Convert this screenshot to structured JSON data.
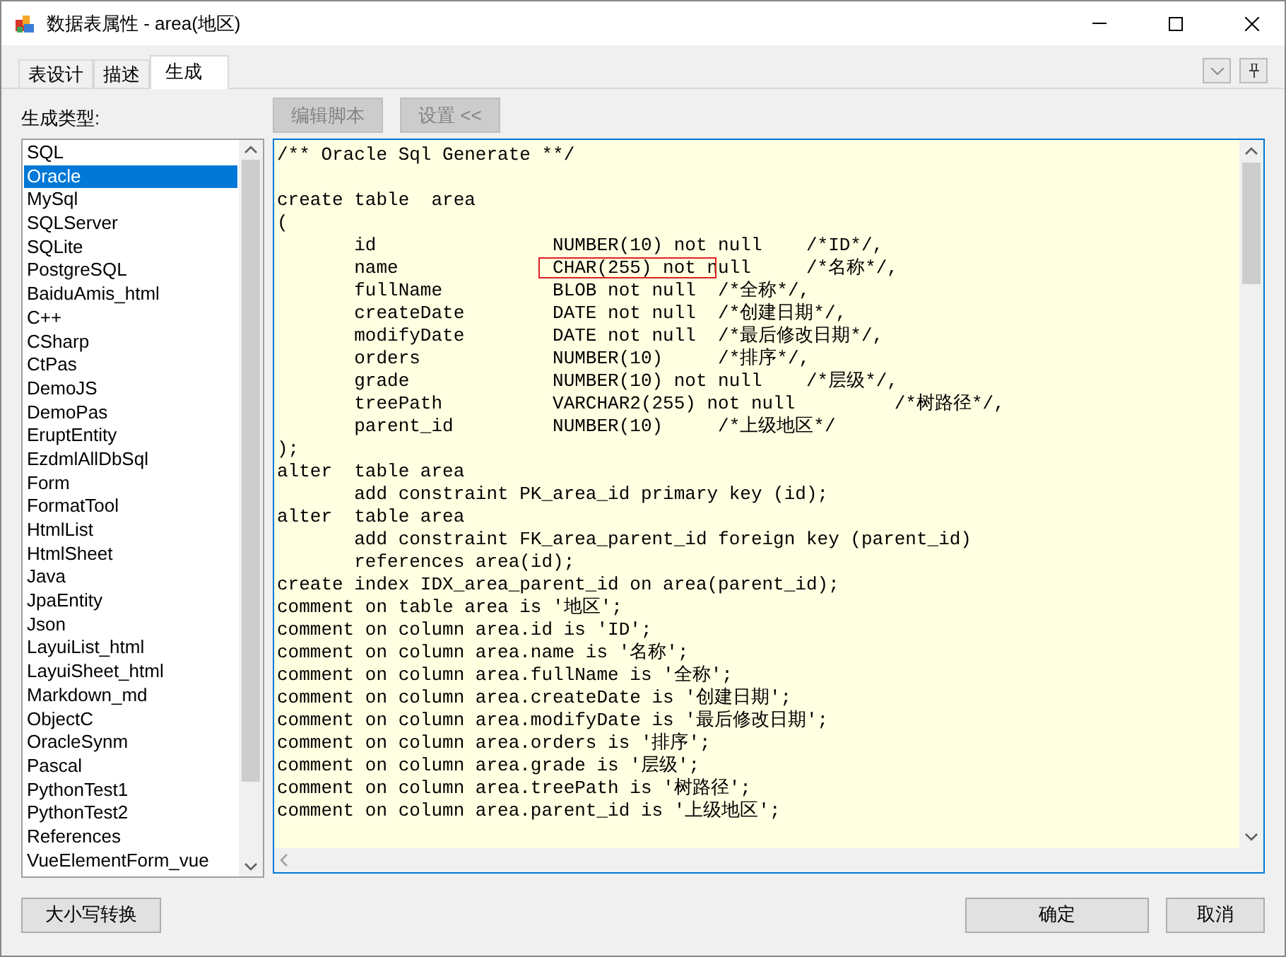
{
  "window": {
    "title": "数据表属性 - area(地区)"
  },
  "tabs": [
    {
      "label": "表设计",
      "selected": false
    },
    {
      "label": "描述",
      "selected": false
    },
    {
      "label": "生成",
      "selected": true
    }
  ],
  "generate_type_label": "生成类型:",
  "toolbar_buttons": [
    {
      "label": "编辑脚本",
      "disabled": true
    },
    {
      "label": "设置 <<",
      "disabled": true
    }
  ],
  "types": [
    {
      "label": "SQL",
      "selected": false
    },
    {
      "label": "Oracle",
      "selected": true
    },
    {
      "label": "MySql",
      "selected": false
    },
    {
      "label": "SQLServer",
      "selected": false
    },
    {
      "label": "SQLite",
      "selected": false
    },
    {
      "label": "PostgreSQL",
      "selected": false
    },
    {
      "label": "BaiduAmis_html",
      "selected": false
    },
    {
      "label": "C++",
      "selected": false
    },
    {
      "label": "CSharp",
      "selected": false
    },
    {
      "label": "CtPas",
      "selected": false
    },
    {
      "label": "DemoJS",
      "selected": false
    },
    {
      "label": "DemoPas",
      "selected": false
    },
    {
      "label": "EruptEntity",
      "selected": false
    },
    {
      "label": "EzdmlAllDbSql",
      "selected": false
    },
    {
      "label": "Form",
      "selected": false
    },
    {
      "label": "FormatTool",
      "selected": false
    },
    {
      "label": "HtmlList",
      "selected": false
    },
    {
      "label": "HtmlSheet",
      "selected": false
    },
    {
      "label": "Java",
      "selected": false
    },
    {
      "label": "JpaEntity",
      "selected": false
    },
    {
      "label": "Json",
      "selected": false
    },
    {
      "label": "LayuiList_html",
      "selected": false
    },
    {
      "label": "LayuiSheet_html",
      "selected": false
    },
    {
      "label": "Markdown_md",
      "selected": false
    },
    {
      "label": "ObjectC",
      "selected": false
    },
    {
      "label": "OracleSynm",
      "selected": false
    },
    {
      "label": "Pascal",
      "selected": false
    },
    {
      "label": "PythonTest1",
      "selected": false
    },
    {
      "label": "PythonTest2",
      "selected": false
    },
    {
      "label": "References",
      "selected": false
    },
    {
      "label": "VueElementForm_vue",
      "selected": false
    }
  ],
  "code_lines": [
    {
      "text": "/** Oracle Sql Generate **/",
      "boxed": false
    },
    {
      "boxed": false
    },
    {
      "text": "create table  area",
      "boxed": false
    },
    {
      "text": "(",
      "boxed": false
    },
    {
      "text": "       id                NUMBER(10) not null    /*ID*/,",
      "boxed": false
    },
    {
      "text": "       name              CHAR(255) not null     /*名称*/,",
      "boxed": true
    },
    {
      "text": "       fullName          BLOB not null  /*全称*/,",
      "boxed": false
    },
    {
      "text": "       createDate        DATE not null  /*创建日期*/,",
      "boxed": false
    },
    {
      "text": "       modifyDate        DATE not null  /*最后修改日期*/,",
      "boxed": false
    },
    {
      "text": "       orders            NUMBER(10)     /*排序*/,",
      "boxed": false
    },
    {
      "text": "       grade             NUMBER(10) not null    /*层级*/,",
      "boxed": false
    },
    {
      "text": "       treePath          VARCHAR2(255) not null         /*树路径*/,",
      "boxed": false
    },
    {
      "text": "       parent_id         NUMBER(10)     /*上级地区*/",
      "boxed": false
    },
    {
      "text": ");",
      "boxed": false
    },
    {
      "text": "alter  table area",
      "boxed": false
    },
    {
      "text": "       add constraint PK_area_id primary key (id);",
      "boxed": false
    },
    {
      "text": "alter  table area",
      "boxed": false
    },
    {
      "text": "       add constraint FK_area_parent_id foreign key (parent_id)",
      "boxed": false
    },
    {
      "text": "       references area(id);",
      "boxed": false
    },
    {
      "text": "create index IDX_area_parent_id on area(parent_id);",
      "boxed": false
    },
    {
      "text": "comment on table area is '地区';",
      "boxed": false
    },
    {
      "text": "comment on column area.id is 'ID';",
      "boxed": false
    },
    {
      "text": "comment on column area.name is '名称';",
      "boxed": false
    },
    {
      "text": "comment on column area.fullName is '全称';",
      "boxed": false
    },
    {
      "text": "comment on column area.createDate is '创建日期';",
      "boxed": false
    },
    {
      "text": "comment on column area.modifyDate is '最后修改日期';",
      "boxed": false
    },
    {
      "text": "comment on column area.orders is '排序';",
      "boxed": false
    },
    {
      "text": "comment on column area.grade is '层级';",
      "boxed": false
    },
    {
      "text": "comment on column area.treePath is '树路径';",
      "boxed": false
    },
    {
      "text": "comment on column area.parent_id is '上级地区';",
      "boxed": false
    }
  ],
  "footer_buttons": {
    "left": [
      "大小写转换"
    ],
    "right": [
      "确定",
      "取消"
    ]
  }
}
